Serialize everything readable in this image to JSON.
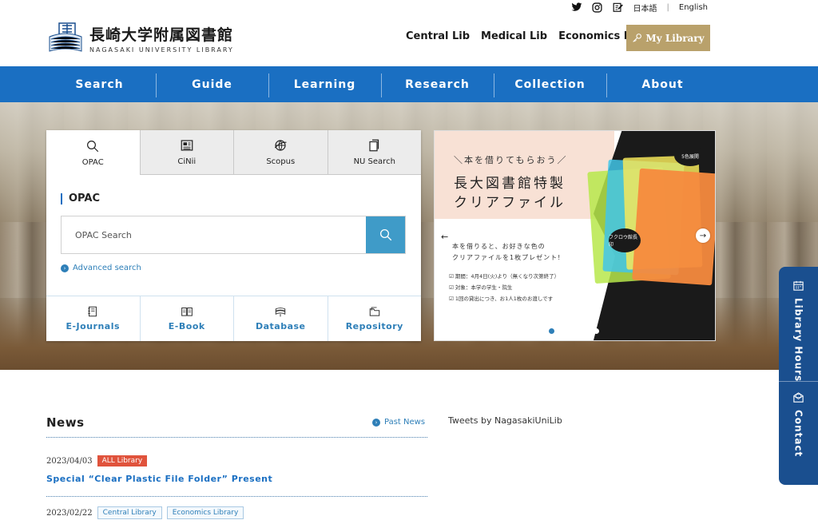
{
  "header": {
    "logo_ja": "長崎大学附属図書館",
    "logo_en": "NAGASAKI UNIVERSITY LIBRARY",
    "utility": {
      "icons": [
        "twitter-icon",
        "instagram-icon",
        "edit-icon"
      ],
      "lang_ja": "日本語",
      "lang_separator": "|",
      "lang_en": "English"
    },
    "lib_links": [
      "Central Lib",
      "Medical Lib",
      "Economics Lib"
    ],
    "my_library": "My Library"
  },
  "nav": [
    "Search",
    "Guide",
    "Learning",
    "Research",
    "Collection",
    "About"
  ],
  "search": {
    "tabs": [
      {
        "label": "OPAC",
        "icon": "search-icon",
        "active": true
      },
      {
        "label": "CiNii",
        "icon": "newspaper-icon",
        "active": false
      },
      {
        "label": "Scopus",
        "icon": "globe-icon",
        "active": false
      },
      {
        "label": "NU Search",
        "icon": "documents-icon",
        "active": false
      }
    ],
    "section_title": "OPAC",
    "placeholder": "OPAC Search",
    "advanced": "Advanced search",
    "quick_links": [
      {
        "label": "E-Journals",
        "icon": "journal-icon"
      },
      {
        "label": "E-Book",
        "icon": "book-icon"
      },
      {
        "label": "Database",
        "icon": "database-icon"
      },
      {
        "label": "Repository",
        "icon": "folder-icon"
      }
    ]
  },
  "banner": {
    "tagline": "＼本を借りてもらおう／",
    "title_line1": "長大図書館特製",
    "title_line2": "クリアファイル",
    "desc_line1": "本を借りると、お好きな色の",
    "desc_line2": "クリアファイルを1枚プレゼント!",
    "list": [
      "期間：4月4日(火)より（無くなり次第終了）",
      "対象：本学の学生・院生",
      "1回の貸出につき、お1人1枚のお渡しです"
    ],
    "bubble_a": "5色展開",
    "bubble_b": "フクロウ館長印",
    "slide_count": 5,
    "active_slide": 1
  },
  "side_tabs": {
    "hours": "Library Hours",
    "contact": "Contact"
  },
  "news": {
    "title": "News",
    "past_news": "Past News",
    "items": [
      {
        "date": "2023/04/03",
        "badges": [
          "ALL Library"
        ],
        "badge_style": "red",
        "title": "Special “Clear Plastic File Folder” Present"
      },
      {
        "date": "2023/02/22",
        "badges": [
          "Central Library",
          "Economics Library"
        ],
        "badge_style": "outline",
        "title": ""
      }
    ]
  },
  "tweets": {
    "label": "Tweets by NagasakiUniLib"
  },
  "colors": {
    "nav_blue": "#1a6fc2",
    "gold": "#b9a16b",
    "search_button": "#3f9bc8",
    "side_tab": "#1a4f8f",
    "badge_red": "#e0533c"
  }
}
